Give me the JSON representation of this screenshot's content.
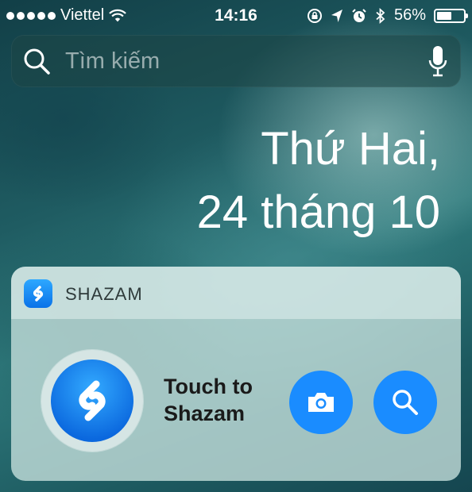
{
  "status_bar": {
    "carrier": "Viettel",
    "time": "14:16",
    "battery_percent": "56%",
    "battery_level": 0.56,
    "icons": [
      "signal-dots",
      "wifi-icon",
      "rotation-lock-icon",
      "location-icon",
      "alarm-icon",
      "bluetooth-icon",
      "battery-icon"
    ]
  },
  "search": {
    "placeholder": "Tìm kiếm",
    "icons": [
      "search-icon",
      "microphone-icon"
    ]
  },
  "date": {
    "line1": "Thứ Hai,",
    "line2": "24 tháng 10"
  },
  "widget": {
    "title": "SHAZAM",
    "touch_line1": "Touch to",
    "touch_line2": "Shazam",
    "accent_color": "#1a8cff",
    "icons": [
      "shazam-logo-icon",
      "camera-icon",
      "search-icon"
    ]
  }
}
